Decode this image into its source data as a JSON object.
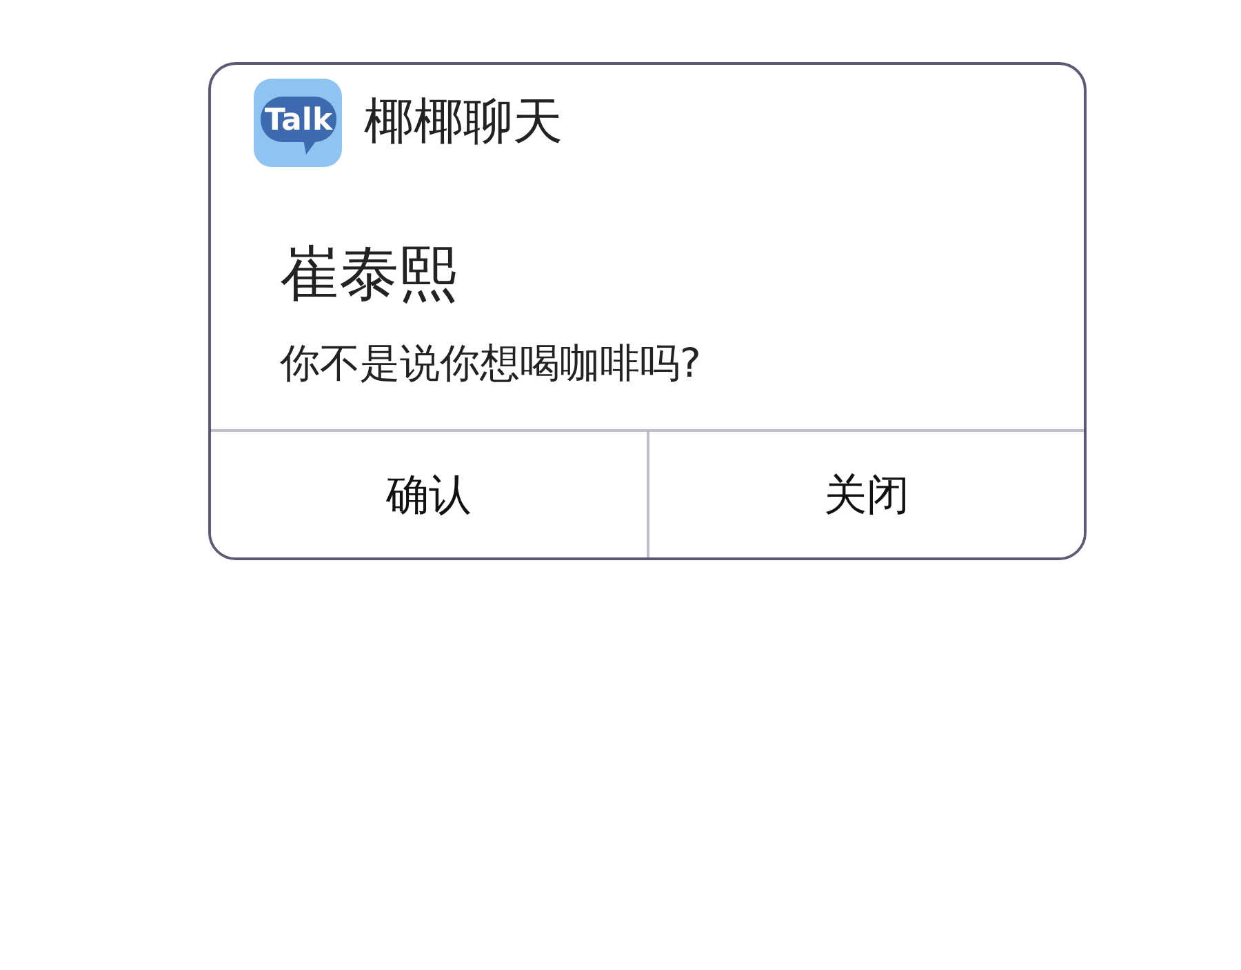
{
  "app": {
    "logo_text": "Talk",
    "name": "椰椰聊天"
  },
  "notification": {
    "sender": "崔泰熙",
    "message": "你不是说你想喝咖啡吗?"
  },
  "buttons": [
    {
      "label": "确认"
    },
    {
      "label": "关闭"
    }
  ]
}
